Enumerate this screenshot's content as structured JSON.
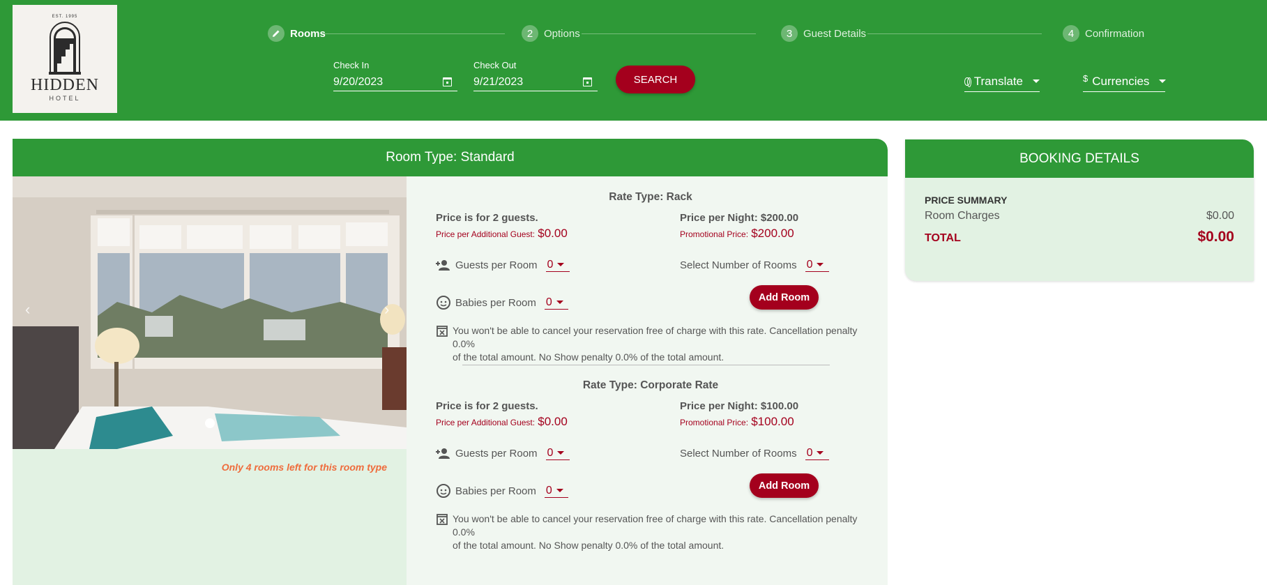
{
  "logo": {
    "est": "EST. 1995",
    "name": "HIDDEN",
    "sub": "HOTEL"
  },
  "stepper": [
    {
      "num": "",
      "label": "Rooms",
      "active": true
    },
    {
      "num": "2",
      "label": "Options",
      "active": false
    },
    {
      "num": "3",
      "label": "Guest Details",
      "active": false
    },
    {
      "num": "4",
      "label": "Confirmation",
      "active": false
    }
  ],
  "search": {
    "check_in_label": "Check In",
    "check_in_value": "9/20/2023",
    "check_out_label": "Check Out",
    "check_out_value": "9/21/2023",
    "button": "SEARCH"
  },
  "translate": {
    "label": "Translate",
    "icon": "globe-icon"
  },
  "currencies": {
    "label": "Currencies",
    "icon": "dollar-icon",
    "symbol": "$"
  },
  "room": {
    "title": "Room Type: Standard",
    "availability_note": "Only 4 rooms left for this room type",
    "rates": [
      {
        "title": "Rate Type: Rack",
        "guests_text": "Price is for 2 guests.",
        "additional_label": "Price per Additional Guest:",
        "additional_value": "$0.00",
        "per_night": "Price per Night: $200.00",
        "promo_label": "Promotional Price:",
        "promo_value": "$200.00",
        "guests_per_room_label": "Guests per Room",
        "guests_per_room_value": "0",
        "babies_per_room_label": "Babies per Room",
        "babies_per_room_value": "0",
        "rooms_label": "Select Number of Rooms",
        "rooms_value": "0",
        "add_button": "Add Room",
        "policy_line1": "You won't be able to cancel your reservation free of charge with this rate. Cancellation penalty 0.0%",
        "policy_line2": "of the total amount. No Show penalty 0.0% of the total amount."
      },
      {
        "title": "Rate Type: Corporate Rate",
        "guests_text": "Price is for 2 guests.",
        "additional_label": "Price per Additional Guest:",
        "additional_value": "$0.00",
        "per_night": "Price per Night: $100.00",
        "promo_label": "Promotional Price:",
        "promo_value": "$100.00",
        "guests_per_room_label": "Guests per Room",
        "guests_per_room_value": "0",
        "babies_per_room_label": "Babies per Room",
        "babies_per_room_value": "0",
        "rooms_label": "Select Number of Rooms",
        "rooms_value": "0",
        "add_button": "Add Room",
        "policy_line1": "You won't be able to cancel your reservation free of charge with this rate. Cancellation penalty 0.0%",
        "policy_line2": "of the total amount. No Show penalty 0.0% of the total amount."
      }
    ]
  },
  "booking": {
    "title": "BOOKING DETAILS",
    "summary_title": "PRICE SUMMARY",
    "room_charges_label": "Room Charges",
    "room_charges_value": "$0.00",
    "total_label": "TOTAL",
    "total_value": "$0.00"
  },
  "colors": {
    "brand_green": "#2e9937",
    "accent_red": "#a4001d",
    "light_green": "#e2f2e3",
    "note_orange": "#ef6c3c"
  }
}
